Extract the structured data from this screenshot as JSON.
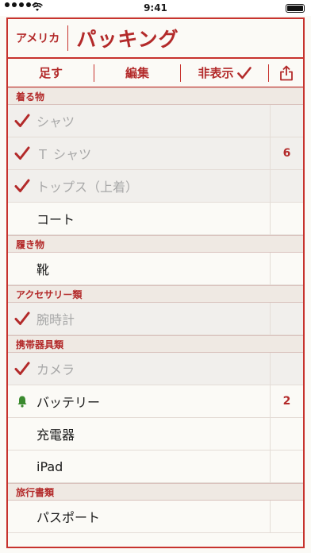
{
  "status_bar": {
    "time": "9:41"
  },
  "header": {
    "trip": "アメリカ",
    "list_title": "パッキング"
  },
  "toolbar": {
    "add": "足す",
    "edit": "編集",
    "hide": "非表示"
  },
  "colors": {
    "accent": "#c7332e",
    "section_bg": "#efe9e3",
    "bell": "#3a8a2e"
  },
  "sections": [
    {
      "title": "着る物",
      "items": [
        {
          "name": "シャツ",
          "checked": true,
          "count": ""
        },
        {
          "name": "Ｔ シャツ",
          "checked": true,
          "count": "6"
        },
        {
          "name": "トップス（上着）",
          "checked": true,
          "count": ""
        },
        {
          "name": "コート",
          "checked": false,
          "count": ""
        }
      ]
    },
    {
      "title": "履き物",
      "items": [
        {
          "name": "靴",
          "checked": false,
          "count": ""
        }
      ]
    },
    {
      "title": "アクセサリー類",
      "items": [
        {
          "name": "腕時計",
          "checked": true,
          "count": ""
        }
      ]
    },
    {
      "title": "携帯器具類",
      "items": [
        {
          "name": "カメラ",
          "checked": true,
          "count": ""
        },
        {
          "name": "バッテリー",
          "checked": false,
          "alert": "bell-icon",
          "count": "2"
        },
        {
          "name": "充電器",
          "checked": false,
          "count": ""
        },
        {
          "name": "iPad",
          "checked": false,
          "count": ""
        }
      ]
    },
    {
      "title": "旅行書類",
      "items": [
        {
          "name": "パスポート",
          "checked": false,
          "count": ""
        }
      ]
    }
  ]
}
